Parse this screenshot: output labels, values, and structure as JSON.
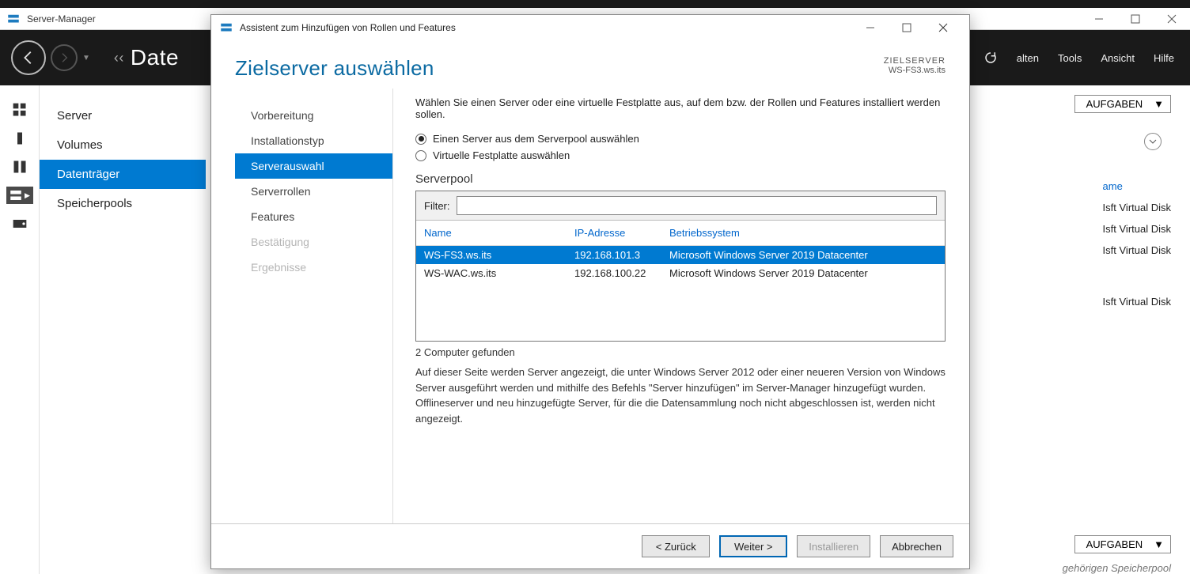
{
  "app": {
    "title": "Server-Manager",
    "breadcrumb_truncated": "Date",
    "menu_truncated": "alten",
    "menu": [
      "Tools",
      "Ansicht",
      "Hilfe"
    ]
  },
  "subnav": {
    "items": [
      {
        "label": "Server"
      },
      {
        "label": "Volumes"
      },
      {
        "label": "Datenträger"
      },
      {
        "label": "Speicherpools"
      }
    ],
    "selected_index": 2
  },
  "tasks_button": "AUFGABEN",
  "bg_list": {
    "header": "ame",
    "rows": [
      "Isft Virtual Disk",
      "Isft Virtual Disk",
      "Isft Virtual Disk",
      "Isft Virtual Disk"
    ]
  },
  "bottom_hint": "gehörigen Speicherpool",
  "wizard": {
    "title": "Assistent zum Hinzufügen von Rollen und Features",
    "heading": "Zielserver auswählen",
    "target_label": "ZIELSERVER",
    "target_value": "WS-FS3.ws.its",
    "steps": [
      {
        "label": "Vorbereitung",
        "state": "normal"
      },
      {
        "label": "Installationstyp",
        "state": "normal"
      },
      {
        "label": "Serverauswahl",
        "state": "active"
      },
      {
        "label": "Serverrollen",
        "state": "normal"
      },
      {
        "label": "Features",
        "state": "normal"
      },
      {
        "label": "Bestätigung",
        "state": "disabled"
      },
      {
        "label": "Ergebnisse",
        "state": "disabled"
      }
    ],
    "intro": "Wählen Sie einen Server oder eine virtuelle Festplatte aus, auf dem bzw. der Rollen und Features installiert werden sollen.",
    "radio1": "Einen Server aus dem Serverpool auswählen",
    "radio2": "Virtuelle Festplatte auswählen",
    "pool_label": "Serverpool",
    "filter_label": "Filter:",
    "filter_value": "",
    "columns": [
      "Name",
      "IP-Adresse",
      "Betriebssystem"
    ],
    "rows": [
      {
        "name": "WS-FS3.ws.its",
        "ip": "192.168.101.3",
        "os": "Microsoft Windows Server 2019 Datacenter",
        "selected": true
      },
      {
        "name": "WS-WAC.ws.its",
        "ip": "192.168.100.22",
        "os": "Microsoft Windows Server 2019 Datacenter",
        "selected": false
      }
    ],
    "count": "2 Computer gefunden",
    "note": "Auf dieser Seite werden Server angezeigt, die unter Windows Server 2012 oder einer neueren Version von Windows Server ausgeführt werden und mithilfe des Befehls \"Server hinzufügen\" im Server-Manager hinzugefügt wurden. Offlineserver und neu hinzugefügte Server, für die die Datensammlung noch nicht abgeschlossen ist, werden nicht angezeigt.",
    "buttons": {
      "back": "< Zurück",
      "next": "Weiter >",
      "install": "Installieren",
      "cancel": "Abbrechen"
    }
  }
}
